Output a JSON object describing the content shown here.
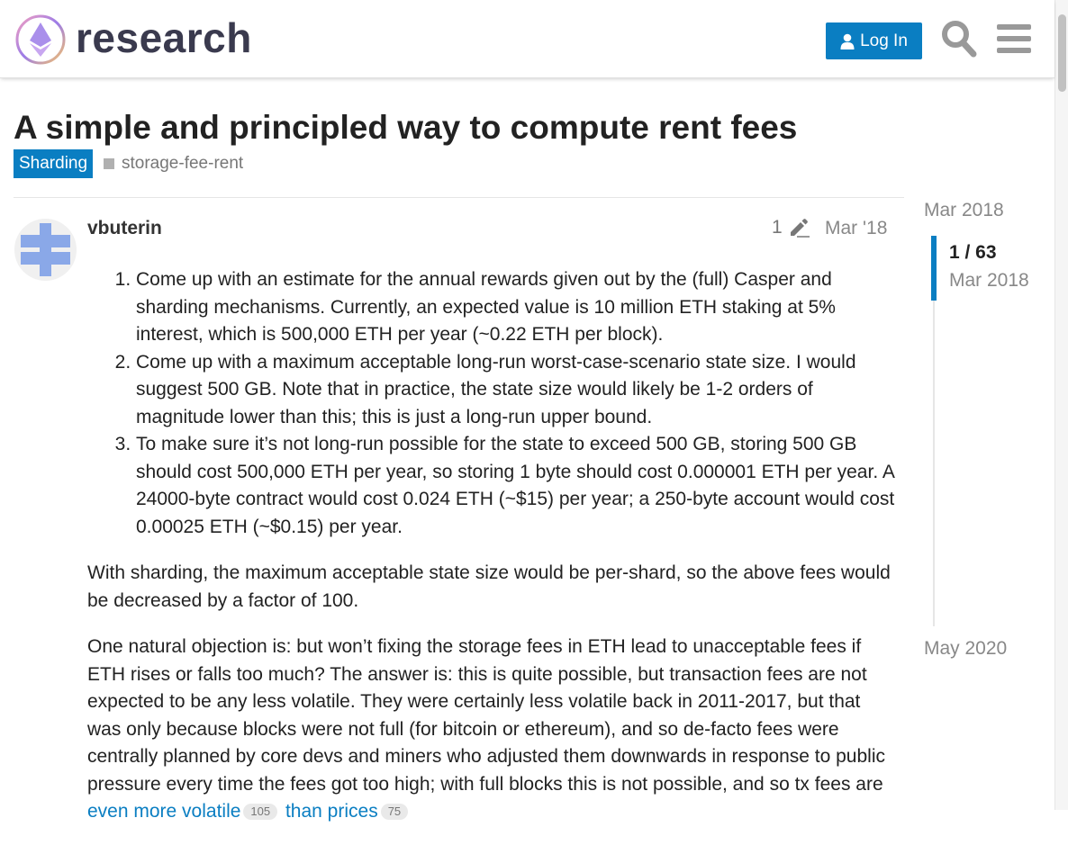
{
  "header": {
    "logo_text": "research",
    "login_label": "Log In",
    "icons": [
      "logo-icon",
      "user-icon",
      "search-icon",
      "menu-icon"
    ]
  },
  "topic": {
    "title": "A simple and principled way to compute rent fees",
    "category": "Sharding",
    "tag": "storage-fee-rent"
  },
  "post": {
    "username": "vbuterin",
    "edits": "1",
    "date": "Mar '18",
    "list_items": [
      "Come up with an estimate for the annual rewards given out by the (full) Casper and sharding mechanisms. Currently, an expected value is 10 million ETH staking at 5% interest, which is 500,000 ETH per year (~0.22 ETH per block).",
      "Come up with a maximum acceptable long-run worst-case-scenario state size. I would suggest 500 GB. Note that in practice, the state size would likely be 1-2 orders of magnitude lower than this; this is just a long-run upper bound.",
      "To make sure it’s not long-run possible for the state to exceed 500 GB, storing 500 GB should cost 500,000 ETH per year, so storing 1 byte should cost 0.000001 ETH per year. A 24000-byte contract would cost 0.024 ETH (~$15) per year; a 250-byte account would cost 0.00025 ETH (~$0.15) per year."
    ],
    "paragraph1": "With sharding, the maximum acceptable state size would be per-shard, so the above fees would be decreased by a factor of 100.",
    "paragraph2": "One natural objection is: but won’t fixing the storage fees in ETH lead to unacceptable fees if ETH rises or falls too much? The answer is: this is quite possible, but transaction fees are not expected to be any less volatile. They were certainly less volatile back in 2011-2017, but that was only because blocks were not full (for bitcoin or ethereum), and so de-facto fees were centrally planned by core devs and miners who adjusted them downwards in response to public pressure every time the fees got too high; with full blocks this is not possible, and",
    "paragraph2_tail": "so tx fees are",
    "link1": "even more volatile",
    "link1_clicks": "105",
    "link2": "than prices",
    "link2_clicks": "75"
  },
  "timeline": {
    "start": "Mar 2018",
    "position": "1 / 63",
    "position_date": "Mar 2018",
    "end": "May 2020"
  },
  "colors": {
    "accent": "#0a7ec2",
    "muted_text": "#888888"
  }
}
